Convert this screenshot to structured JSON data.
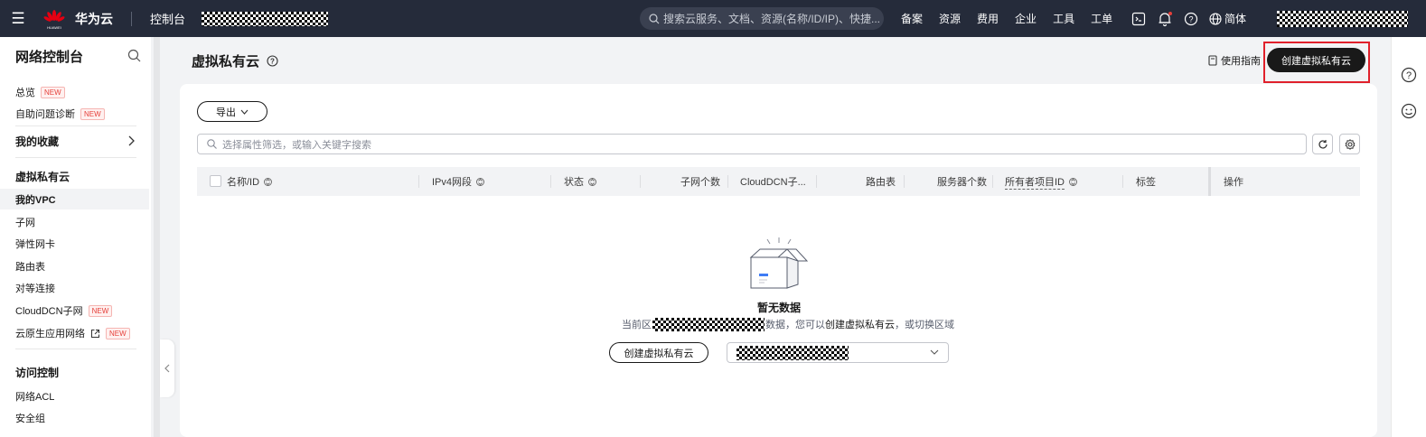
{
  "topbar": {
    "brand": "华为云",
    "logo_text": "HUAWEI",
    "console": "控制台",
    "search_placeholder": "搜索云服务、文档、资源(名称/ID/IP)、快捷...",
    "nav": [
      "备案",
      "资源",
      "费用",
      "企业",
      "工具",
      "工单"
    ],
    "language": "简体"
  },
  "sidebar": {
    "title": "网络控制台",
    "new_badge": "NEW",
    "overview": "总览",
    "self_diagnosis": "自助问题诊断",
    "favorites": "我的收藏",
    "vpc_group": "虚拟私有云",
    "my_vpc": "我的VPC",
    "subnet": "子网",
    "eni": "弹性网卡",
    "route_table": "路由表",
    "peering": "对等连接",
    "clouddcn": "CloudDCN子网",
    "cloud_native": "云原生应用网络",
    "access_control": "访问控制",
    "network_acl": "网络ACL",
    "security_group": "安全组"
  },
  "header": {
    "title": "虚拟私有云",
    "guide": "使用指南",
    "create_button": "创建虚拟私有云"
  },
  "toolbar": {
    "export": "导出",
    "filter_placeholder": "选择属性筛选，或输入关键字搜索"
  },
  "table": {
    "columns": {
      "name_id": "名称/ID",
      "ipv4": "IPv4网段",
      "status": "状态",
      "subnet_count": "子网个数",
      "clouddcn": "CloudDCN子...",
      "route_table": "路由表",
      "server_count": "服务器个数",
      "owner_project": "所有者项目ID",
      "tags": "标签",
      "operation": "操作"
    }
  },
  "empty": {
    "title": "暂无数据",
    "desc_prefix": "当前区",
    "desc_middle": "数据，您可以",
    "desc_link": "创建虚拟私有云",
    "desc_suffix": "，或切换区域",
    "create_button": "创建虚拟私有云"
  }
}
